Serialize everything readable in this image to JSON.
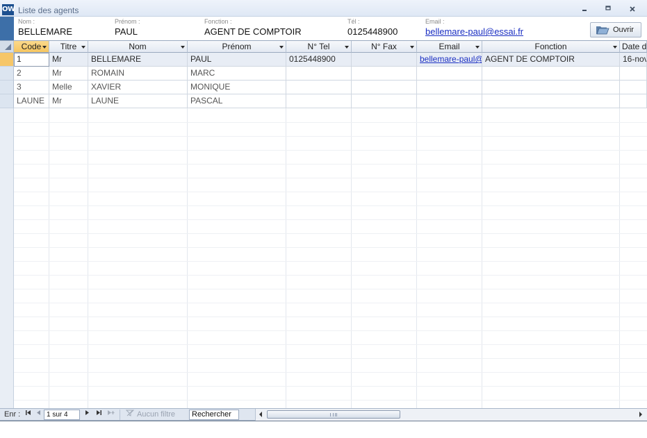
{
  "window": {
    "app_icon": "OW",
    "title": "Liste des agents",
    "minimize_icon": "minimize-icon",
    "maximize_icon": "maximize-icon",
    "close_icon": "close-icon"
  },
  "header": {
    "fields": [
      {
        "label": "Nom :",
        "value": "BELLEMARE"
      },
      {
        "label": "Prénom :",
        "value": "PAUL"
      },
      {
        "label": "Fonction :",
        "value": "AGENT DE COMPTOIR"
      },
      {
        "label": "Tél :",
        "value": "0125448900"
      },
      {
        "label": "Email :",
        "value": "bellemare-paul@essai.fr"
      }
    ],
    "open_button": {
      "label": "Ouvrir",
      "icon": "folder-open-icon"
    }
  },
  "grid": {
    "columns": [
      "Code",
      "Titre",
      "Nom",
      "Prénom",
      "N° Tel",
      "N° Fax",
      "Email",
      "Fonction",
      "Date d"
    ],
    "rows": [
      [
        "1",
        "Mr",
        "BELLEMARE",
        "PAUL",
        "0125448900",
        "",
        "bellemare-paul@",
        "AGENT DE COMPTOIR",
        "16-nov"
      ],
      [
        "2",
        "Mr",
        "ROMAIN",
        "MARC",
        "",
        "",
        "",
        "",
        ""
      ],
      [
        "3",
        "Melle",
        "XAVIER",
        "MONIQUE",
        "",
        "",
        "",
        "",
        ""
      ],
      [
        "LAUNE",
        "Mr",
        "LAUNE",
        "PASCAL",
        "",
        "",
        "",
        "",
        ""
      ]
    ],
    "current_row": 0
  },
  "navigation": {
    "label": "Enr :",
    "record": "1 sur 4",
    "filter_label": "Aucun filtre",
    "search_placeholder": "Rechercher",
    "first_icon": "first-record-icon",
    "prev_icon": "previous-record-icon",
    "next_icon": "next-record-icon",
    "last_icon": "last-record-icon",
    "new_icon": "new-record-icon",
    "filter_icon": "filter-icon"
  },
  "colors": {
    "accent": "#3d6fa8",
    "header_active": "#f5c560",
    "link": "#1a2ec2"
  }
}
